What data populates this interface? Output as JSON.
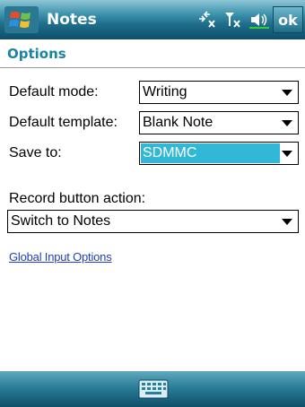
{
  "titlebar": {
    "app_title": "Notes",
    "ok_label": "ok",
    "icons": [
      "windows-start-icon",
      "connectivity-icon",
      "signal-icon",
      "speaker-icon"
    ]
  },
  "page": {
    "title": "Options"
  },
  "form": {
    "default_mode": {
      "label": "Default mode:",
      "value": "Writing"
    },
    "default_template": {
      "label": "Default template:",
      "value": "Blank Note"
    },
    "save_to": {
      "label": "Save to:",
      "value": "SDMMC"
    },
    "record_action": {
      "label": "Record button action:",
      "value": "Switch to Notes"
    }
  },
  "links": {
    "global_input": "Global Input Options"
  },
  "bottombar": {
    "icon": "keyboard-icon"
  },
  "colors": {
    "accent": "#1c84a3",
    "selection": "#33b7d6",
    "link": "#1f3fbd"
  }
}
